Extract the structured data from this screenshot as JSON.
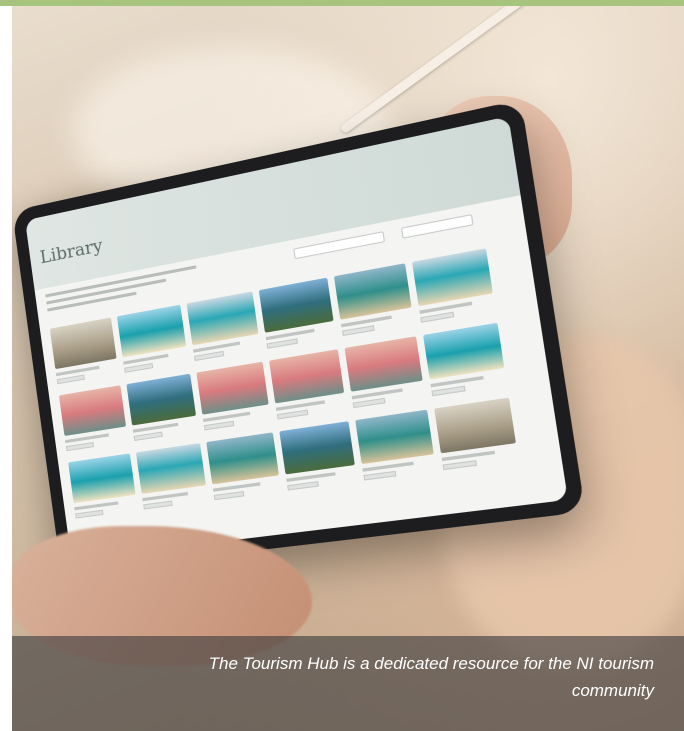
{
  "caption": {
    "text": "The Tourism Hub is a dedicated resource for the NI tourism community"
  },
  "tablet": {
    "page_title": "Library"
  },
  "colors": {
    "accent_bar": "#a7c47f",
    "caption_band": "#3c3c3e"
  }
}
